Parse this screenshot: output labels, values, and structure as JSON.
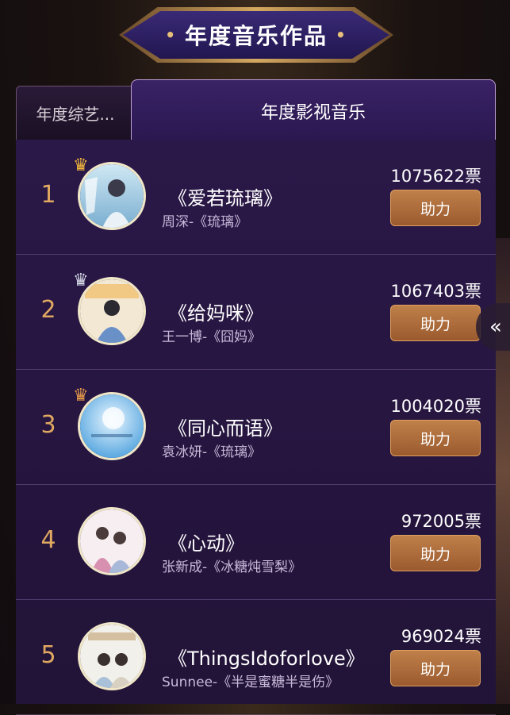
{
  "header": {
    "title": "年度音乐作品",
    "left_dot": "•",
    "right_dot": "•"
  },
  "tabs": [
    {
      "label": "年度综艺..."
    },
    {
      "label": "年度影视音乐"
    }
  ],
  "items": [
    {
      "rank": "1",
      "title": "《爱若琉璃》",
      "subtitle": "周深-《琉璃》",
      "votes": "1075622票",
      "button": "助力",
      "crown": "gold"
    },
    {
      "rank": "2",
      "title": "《给妈咪》",
      "subtitle": "王一博-《囧妈》",
      "votes": "1067403票",
      "button": "助力",
      "crown": "silver"
    },
    {
      "rank": "3",
      "title": "《同心而语》",
      "subtitle": "袁冰妍-《琉璃》",
      "votes": "1004020票",
      "button": "助力",
      "crown": "bronze"
    },
    {
      "rank": "4",
      "title": "《心动》",
      "subtitle": "张新成-《冰糖炖雪梨》",
      "votes": "972005票",
      "button": "助力"
    },
    {
      "rank": "5",
      "title": "《ThingsIdoforlove》",
      "subtitle": "Sunnee-《半是蜜糖半是伤》",
      "votes": "969024票",
      "button": "助力"
    }
  ],
  "side_arrow": {
    "icon": "double-chevron-left-icon",
    "glyph": "«"
  },
  "colors": {
    "accent_gold": "#e0a860",
    "button": "#b06f3c",
    "panel": "#2a1848"
  }
}
